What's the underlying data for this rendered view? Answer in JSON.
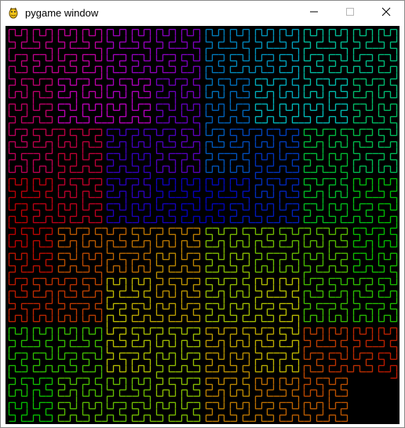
{
  "window": {
    "title": "pygame window",
    "icon": "pygame-snake-icon",
    "controls": {
      "minimize_icon": "minimize-icon",
      "maximize_icon": "maximize-icon",
      "close_icon": "close-icon"
    }
  },
  "canvas": {
    "background": "#000000",
    "content": "hilbert-curve",
    "order": 6,
    "drawn_fraction": 0.985,
    "color_mode": "hue-rainbow",
    "palette": [
      "#ff0000",
      "#ffa000",
      "#ffff00",
      "#00ff00",
      "#00ffff",
      "#0080ff",
      "#0000ff",
      "#8000ff",
      "#ff00ff"
    ]
  }
}
